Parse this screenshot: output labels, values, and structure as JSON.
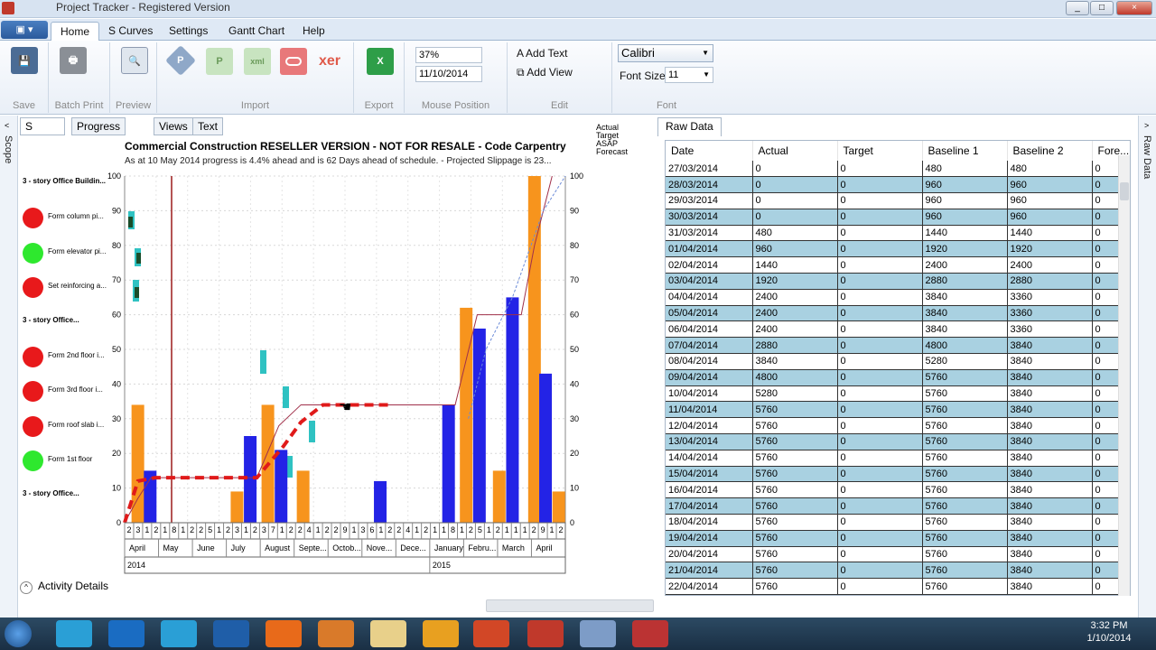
{
  "window": {
    "title": "Project Tracker - Registered Version",
    "buttons": [
      "_",
      "□",
      "×"
    ]
  },
  "ribbon_tabs": [
    "Home",
    "S Curves",
    "Settings",
    "Gantt Chart",
    "Help"
  ],
  "ribbon_groups": {
    "save": "Save",
    "batch_print": "Batch Print",
    "preview": "Preview",
    "import": "Import",
    "export": "Export",
    "mouse_position": "Mouse Position",
    "edit": "Edit",
    "font": "Font"
  },
  "import_icons": [
    "P",
    "P",
    "xml",
    "",
    "xer"
  ],
  "mouse_position": {
    "value1": "37%",
    "value2": "11/10/2014"
  },
  "edit": {
    "add_text": "Add Text",
    "add_view": "Add View"
  },
  "font": {
    "family": "Calibri",
    "size_label": "Font Size",
    "size": "11"
  },
  "side_labels": {
    "left": "Scope",
    "right": "Raw Data"
  },
  "center_tabs": [
    "S Curves",
    "Progress Report",
    "Views",
    "Text"
  ],
  "chart_data": {
    "type": "bar",
    "title": "Commercial Construction RESELLER VERSION - NOT FOR RESALE - Code Carpentry",
    "subtitle": "As at  10 May 2014 progress is  4.4% ahead and is 62 Days ahead of schedule.  - Projected Slippage is  23...",
    "legend": [
      "Actual",
      "Target",
      "ASAP",
      "Forecast"
    ],
    "yticks": [
      0,
      10,
      20,
      30,
      40,
      50,
      60,
      70,
      80,
      90,
      100
    ],
    "ylim": [
      0,
      100
    ],
    "months": [
      "April",
      "May",
      "June",
      "July",
      "August",
      "Septe...",
      "Octob...",
      "Nove...",
      "Dece...",
      "January",
      "Febru...",
      "March",
      "April"
    ],
    "years": [
      "2014",
      "2015"
    ],
    "day_ticks": [
      "2",
      "3",
      "1",
      "2",
      "1",
      "8",
      "1",
      "2",
      "2",
      "5",
      "1",
      "2",
      "3",
      "1",
      "2",
      "3",
      "7",
      "1",
      "2",
      "2",
      "4",
      "1",
      "2",
      "2",
      "9",
      "1",
      "3",
      "6",
      "1",
      "2",
      "2",
      "4",
      "1",
      "2",
      "1",
      "1",
      "8",
      "1",
      "2",
      "5",
      "1",
      "2",
      "1",
      "1",
      "1",
      "2",
      "9",
      "1",
      "2"
    ],
    "orange_bars": [
      {
        "x": 0.03,
        "v": 34
      },
      {
        "x": 0.255,
        "v": 9
      },
      {
        "x": 0.325,
        "v": 34
      },
      {
        "x": 0.405,
        "v": 15
      },
      {
        "x": 0.775,
        "v": 62
      },
      {
        "x": 0.85,
        "v": 15
      },
      {
        "x": 0.93,
        "v": 100
      },
      {
        "x": 0.985,
        "v": 9
      }
    ],
    "blue_bars": [
      {
        "x": 0.058,
        "v": 15
      },
      {
        "x": 0.285,
        "v": 25
      },
      {
        "x": 0.355,
        "v": 21
      },
      {
        "x": 0.58,
        "v": 12
      },
      {
        "x": 0.735,
        "v": 34
      },
      {
        "x": 0.805,
        "v": 56
      },
      {
        "x": 0.88,
        "v": 65
      },
      {
        "x": 0.955,
        "v": 43
      }
    ],
    "target_line": [
      [
        0,
        0
      ],
      [
        0.03,
        7
      ],
      [
        0.06,
        13
      ],
      [
        0.3,
        13
      ],
      [
        0.35,
        28
      ],
      [
        0.4,
        34
      ],
      [
        0.75,
        34
      ],
      [
        0.8,
        60
      ],
      [
        0.9,
        60
      ],
      [
        0.93,
        80
      ],
      [
        0.97,
        100
      ]
    ],
    "forecast_line": [
      [
        0,
        0
      ],
      [
        0.03,
        12
      ],
      [
        0.07,
        13
      ],
      [
        0.3,
        13
      ],
      [
        0.36,
        22
      ],
      [
        0.4,
        29
      ],
      [
        0.45,
        34
      ],
      [
        0.6,
        34
      ]
    ],
    "asap_line": [
      [
        0.78,
        30
      ],
      [
        0.82,
        50
      ],
      [
        0.88,
        65
      ],
      [
        0.95,
        90
      ],
      [
        1,
        100
      ]
    ]
  },
  "activities": [
    {
      "type": "group",
      "label": "3 - story Office Buildin..."
    },
    {
      "type": "task",
      "label": "Form column pi...",
      "color": "red"
    },
    {
      "type": "task",
      "label": "Form elevator pi...",
      "color": "green"
    },
    {
      "type": "task",
      "label": "Set reinforcing a...",
      "color": "red"
    },
    {
      "type": "group",
      "label": "3 - story Office..."
    },
    {
      "type": "task",
      "label": "Form 2nd floor i...",
      "color": "red"
    },
    {
      "type": "task",
      "label": "Form 3rd floor i...",
      "color": "red"
    },
    {
      "type": "task",
      "label": "Form roof slab i...",
      "color": "red"
    },
    {
      "type": "task",
      "label": "Form 1st floor",
      "color": "green"
    },
    {
      "type": "group",
      "label": "3 - story Office..."
    }
  ],
  "activity_details_label": "Activity Details",
  "raw_data": {
    "tab": "Raw Data",
    "columns": [
      "Date",
      "Actual",
      "Target",
      "Baseline 1",
      "Baseline 2",
      "Fore..."
    ],
    "rows": [
      [
        "27/03/2014",
        "0",
        "0",
        "480",
        "480",
        "0"
      ],
      [
        "28/03/2014",
        "0",
        "0",
        "960",
        "960",
        "0"
      ],
      [
        "29/03/2014",
        "0",
        "0",
        "960",
        "960",
        "0"
      ],
      [
        "30/03/2014",
        "0",
        "0",
        "960",
        "960",
        "0"
      ],
      [
        "31/03/2014",
        "480",
        "0",
        "1440",
        "1440",
        "0"
      ],
      [
        "01/04/2014",
        "960",
        "0",
        "1920",
        "1920",
        "0"
      ],
      [
        "02/04/2014",
        "1440",
        "0",
        "2400",
        "2400",
        "0"
      ],
      [
        "03/04/2014",
        "1920",
        "0",
        "2880",
        "2880",
        "0"
      ],
      [
        "04/04/2014",
        "2400",
        "0",
        "3840",
        "3360",
        "0"
      ],
      [
        "05/04/2014",
        "2400",
        "0",
        "3840",
        "3360",
        "0"
      ],
      [
        "06/04/2014",
        "2400",
        "0",
        "3840",
        "3360",
        "0"
      ],
      [
        "07/04/2014",
        "2880",
        "0",
        "4800",
        "3840",
        "0"
      ],
      [
        "08/04/2014",
        "3840",
        "0",
        "5280",
        "3840",
        "0"
      ],
      [
        "09/04/2014",
        "4800",
        "0",
        "5760",
        "3840",
        "0"
      ],
      [
        "10/04/2014",
        "5280",
        "0",
        "5760",
        "3840",
        "0"
      ],
      [
        "11/04/2014",
        "5760",
        "0",
        "5760",
        "3840",
        "0"
      ],
      [
        "12/04/2014",
        "5760",
        "0",
        "5760",
        "3840",
        "0"
      ],
      [
        "13/04/2014",
        "5760",
        "0",
        "5760",
        "3840",
        "0"
      ],
      [
        "14/04/2014",
        "5760",
        "0",
        "5760",
        "3840",
        "0"
      ],
      [
        "15/04/2014",
        "5760",
        "0",
        "5760",
        "3840",
        "0"
      ],
      [
        "16/04/2014",
        "5760",
        "0",
        "5760",
        "3840",
        "0"
      ],
      [
        "17/04/2014",
        "5760",
        "0",
        "5760",
        "3840",
        "0"
      ],
      [
        "18/04/2014",
        "5760",
        "0",
        "5760",
        "3840",
        "0"
      ],
      [
        "19/04/2014",
        "5760",
        "0",
        "5760",
        "3840",
        "0"
      ],
      [
        "20/04/2014",
        "5760",
        "0",
        "5760",
        "3840",
        "0"
      ],
      [
        "21/04/2014",
        "5760",
        "0",
        "5760",
        "3840",
        "0"
      ],
      [
        "22/04/2014",
        "5760",
        "0",
        "5760",
        "3840",
        "0"
      ]
    ]
  },
  "taskbar": {
    "icons": [
      "start-orb",
      "tracker-icon",
      "outlook-icon",
      "tracker2-icon",
      "t-icon",
      "firefox-icon",
      "paint-icon",
      "notes-icon",
      "flower-icon",
      "powerpoint-icon",
      "oracle-icon",
      "primavera-icon",
      "box-icon"
    ],
    "time": "3:32 PM",
    "date": "1/10/2014"
  }
}
